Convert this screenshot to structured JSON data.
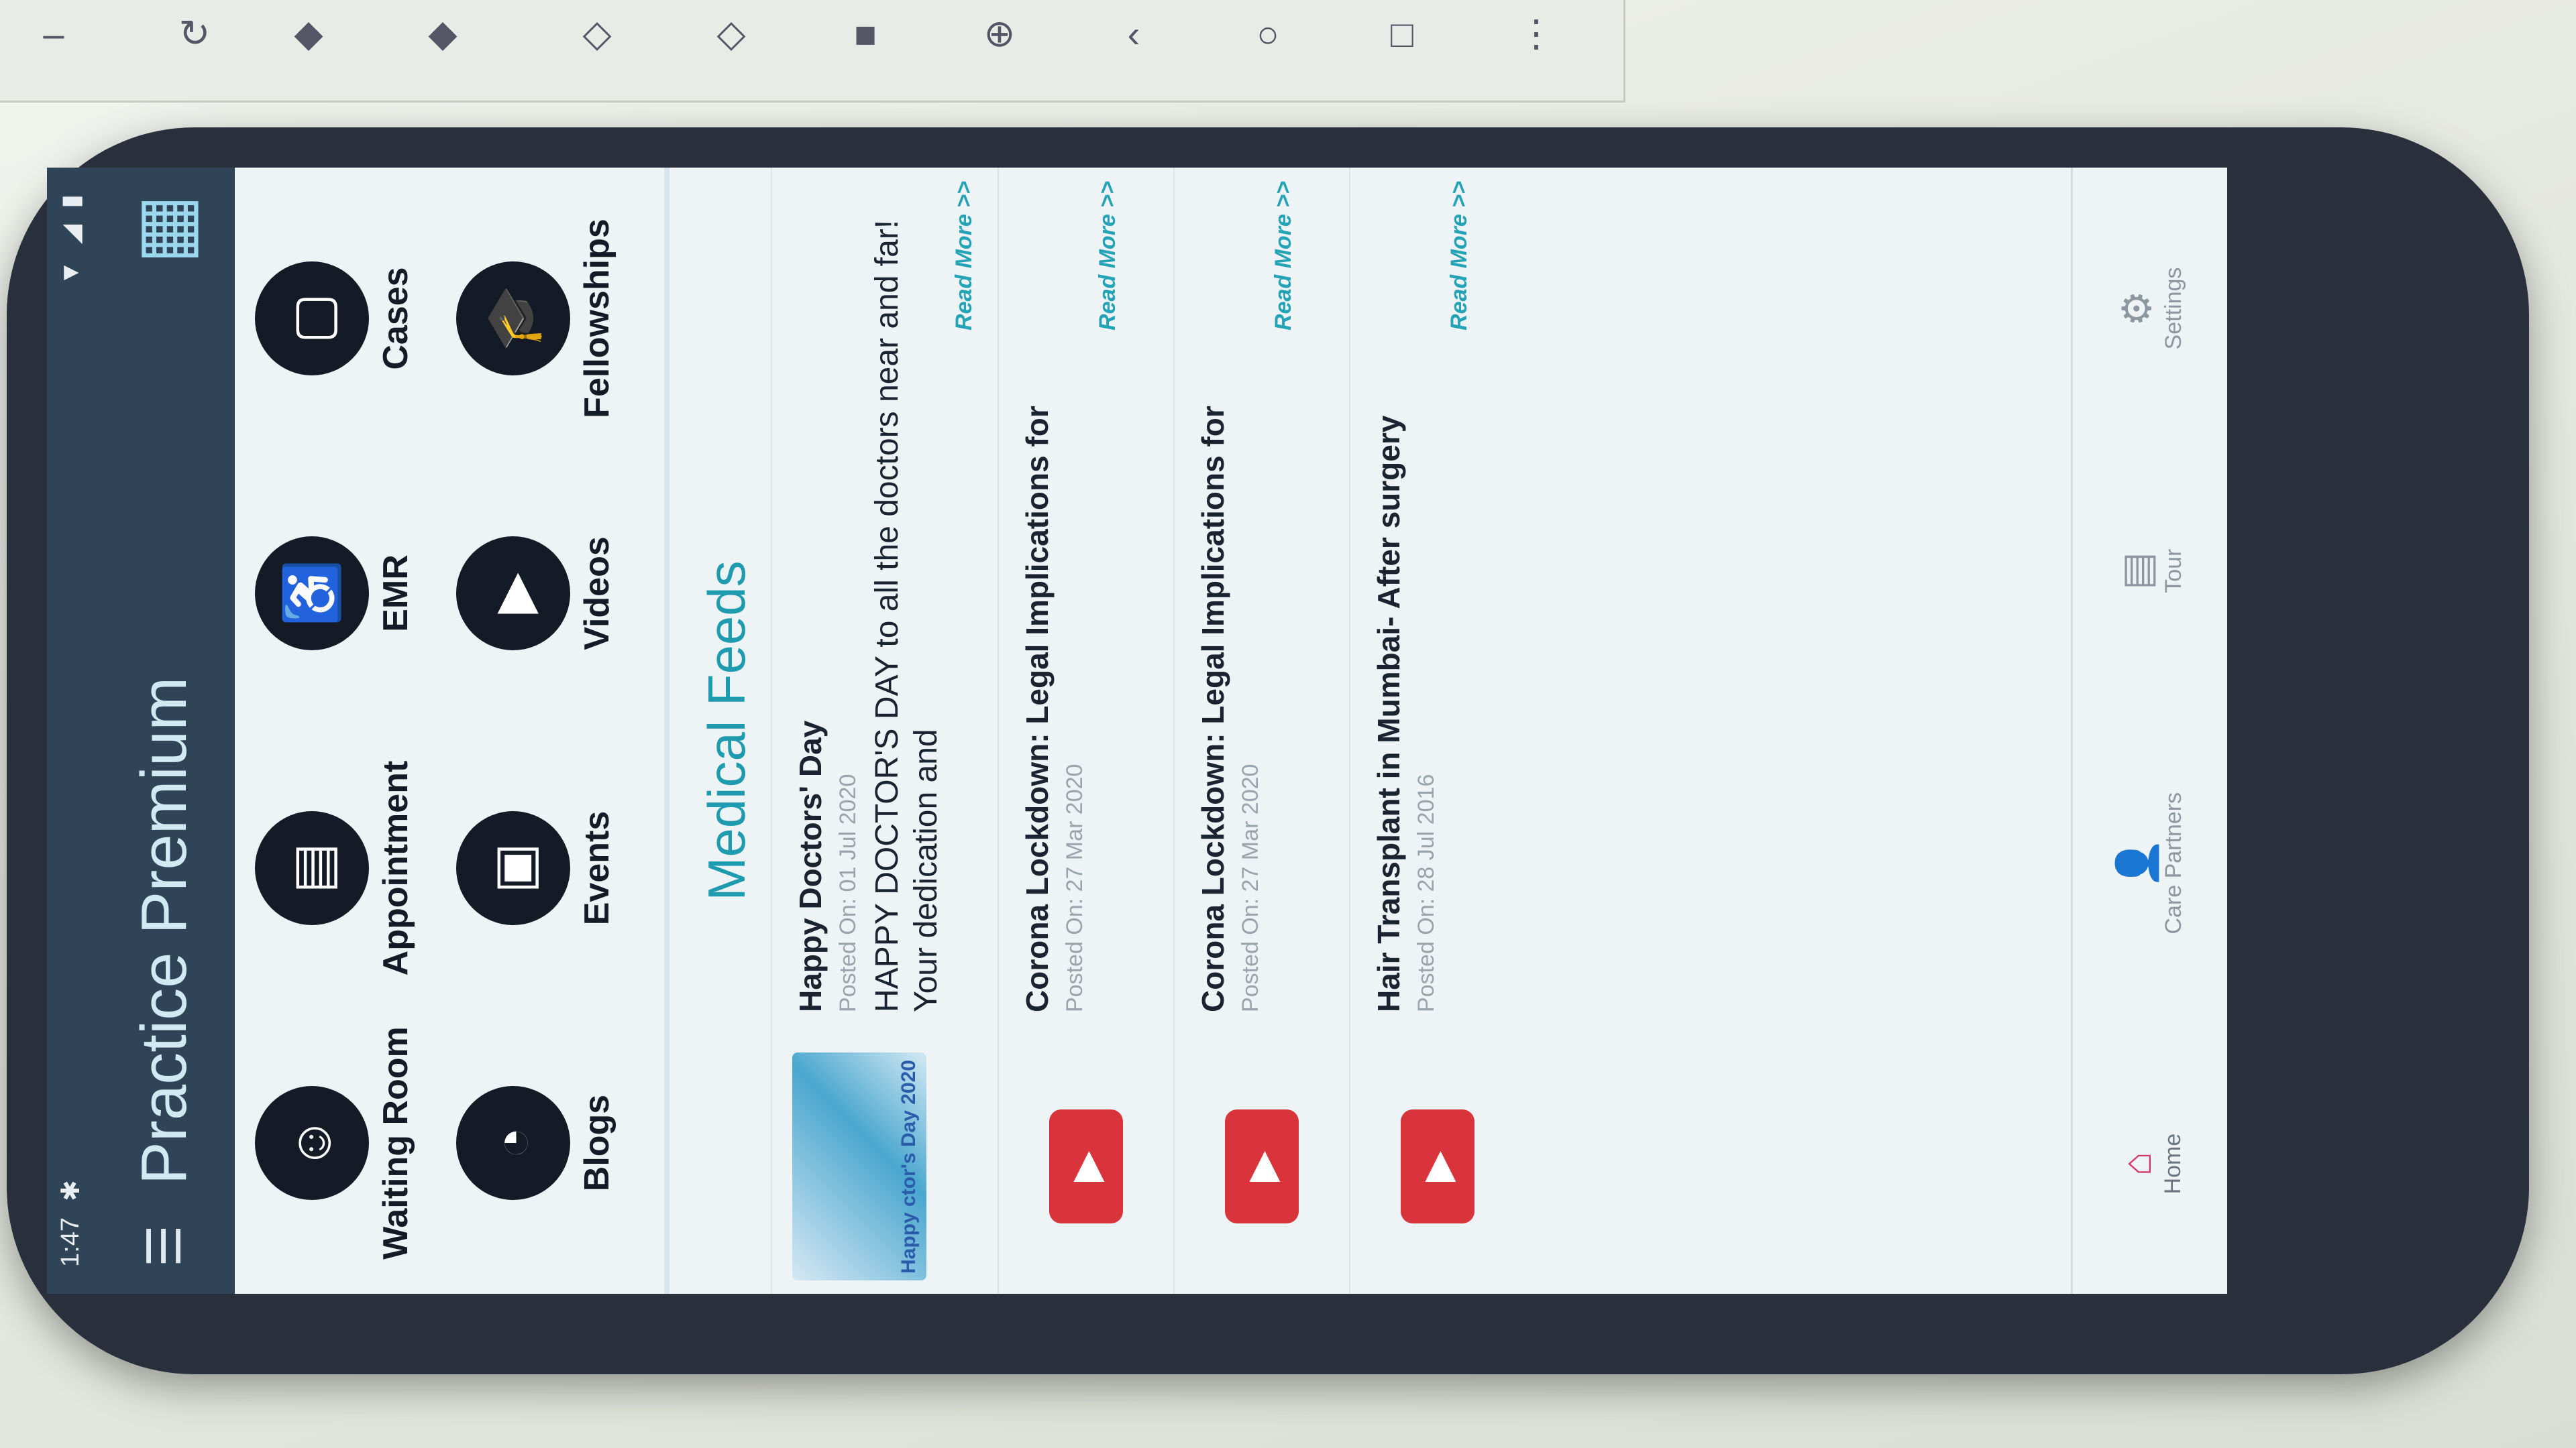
{
  "status": {
    "time": "1:47",
    "settings_icon": "gear-icon",
    "wifi_icon": "wifi-icon",
    "signal_icon": "signal-icon",
    "battery_icon": "battery-icon"
  },
  "header": {
    "title": "Practice Premium",
    "menu_icon": "hamburger-icon",
    "clinic_icon": "hospital-building-icon"
  },
  "tiles": [
    {
      "label": "Waiting Room",
      "icon": "people-icon"
    },
    {
      "label": "Appointment",
      "icon": "calendar-clock-icon"
    },
    {
      "label": "EMR",
      "icon": "wheelchair-icon"
    },
    {
      "label": "Cases",
      "icon": "folder-icon"
    },
    {
      "label": "Blogs",
      "icon": "rss-icon"
    },
    {
      "label": "Events",
      "icon": "calendar-check-icon"
    },
    {
      "label": "Videos",
      "icon": "video-camera-icon"
    },
    {
      "label": "Fellowships",
      "icon": "graduation-cap-icon"
    }
  ],
  "feeds": {
    "title": "Medical Feeds",
    "items": [
      {
        "title": "Happy Doctors' Day",
        "date": "Posted On: 01 Jul 2020",
        "body": "HAPPY DOCTOR'S DAY to all the doctors near and far! Your dedication and",
        "more": "Read More >>",
        "thumb": "image",
        "thumb_text": "Happy ctor's Day 2020"
      },
      {
        "title": "Corona Lockdown: Legal Implications for",
        "date": "Posted On: 27 Mar 2020",
        "body": "",
        "more": "Read More >>",
        "thumb": "youtube"
      },
      {
        "title": "Corona Lockdown: Legal Implications for",
        "date": "Posted On: 27 Mar 2020",
        "body": "",
        "more": "Read More >>",
        "thumb": "youtube"
      },
      {
        "title": "Hair Transplant in Mumbai- After surgery",
        "date": "Posted On: 28 Jul 2016",
        "body": "",
        "more": "Read More >>",
        "thumb": "youtube"
      }
    ]
  },
  "bottom_tabs": [
    {
      "label": "Home",
      "icon": "home-icon",
      "active": true
    },
    {
      "label": "Care Partners",
      "icon": "user-icon",
      "active": false
    },
    {
      "label": "Tour",
      "icon": "tour-icon",
      "active": false
    },
    {
      "label": "Settings",
      "icon": "settings-user-icon",
      "active": false
    }
  ],
  "android_nav": {
    "back": "back-icon",
    "home": "home-circle-icon",
    "recents": "recents-icon"
  }
}
